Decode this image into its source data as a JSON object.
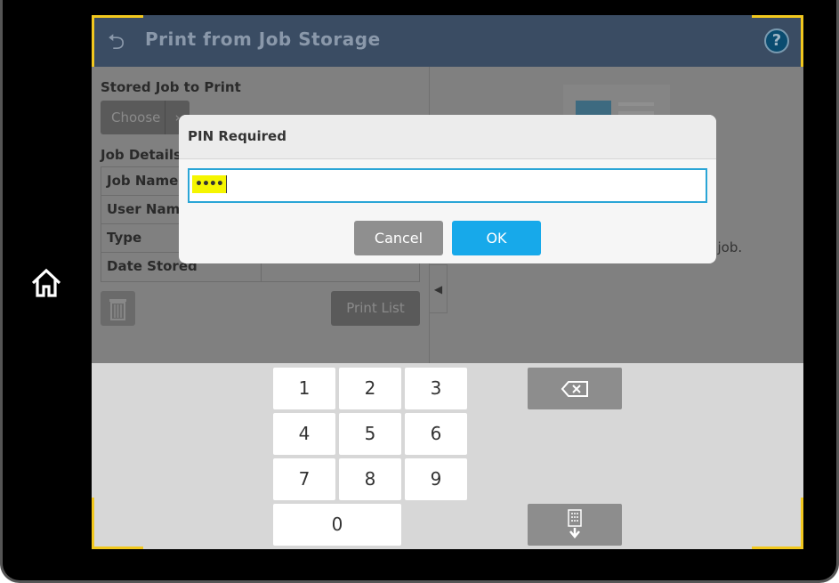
{
  "header": {
    "title": "Print from Job Storage",
    "back_icon": "back-arrow-icon",
    "help_icon": "help-icon",
    "help_label": "?"
  },
  "left": {
    "stored_job_label": "Stored Job to Print",
    "choose_label": "Choose",
    "job_details_label": "Job Details",
    "rows": [
      "Job Name",
      "User Name",
      "Type",
      "Date Stored"
    ],
    "print_list_label": "Print List"
  },
  "right": {
    "hint_text": "ne job."
  },
  "dialog": {
    "title": "PIN Required",
    "pin_value": "••••",
    "cancel_label": "Cancel",
    "ok_label": "OK"
  },
  "keypad": {
    "keys": [
      "1",
      "2",
      "3",
      "4",
      "5",
      "6",
      "7",
      "8",
      "9",
      "0"
    ]
  },
  "colors": {
    "header": "#3a4c63",
    "accent": "#17a9ea",
    "highlight": "#f5f500",
    "corner": "#f2c81e"
  }
}
